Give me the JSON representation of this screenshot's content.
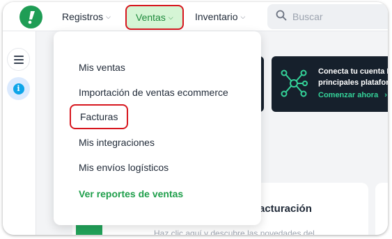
{
  "nav": {
    "logo_icon": "exclamation-logo-icon",
    "items": [
      {
        "label": "Registros"
      },
      {
        "label": "Ventas",
        "active": true
      },
      {
        "label": "Inventario"
      }
    ],
    "chevron": "⌵"
  },
  "search": {
    "placeholder": "Buscar",
    "value": ""
  },
  "sidebar": {
    "items": [
      {
        "icon": "hamburger-menu-icon"
      },
      {
        "icon": "info-icon",
        "glyph": "i"
      }
    ]
  },
  "dropdown": {
    "items": [
      {
        "label": "Mis ventas"
      },
      {
        "label": "Importación de ventas ecommerce"
      },
      {
        "label": "Facturas",
        "highlighted": true
      },
      {
        "label": "Mis integraciones"
      },
      {
        "label": "Mis envíos logísticos"
      }
    ],
    "report_link": "Ver reportes de ventas"
  },
  "background": {
    "promo_card": {
      "line1": "Conecta tu cuenta E",
      "line2": "principales platafor",
      "cta": "Comenzar ahora",
      "cta_arrow": "›"
    },
    "billing_card": {
      "title": "o de facturación",
      "subtitle": "Haz clic aquí y descubre las novedades del"
    }
  },
  "colors": {
    "brand_green": "#1f9d55",
    "active_bg": "#d5f5d5",
    "annotation_red": "#d7151d",
    "link_green": "#1e9e4a"
  }
}
